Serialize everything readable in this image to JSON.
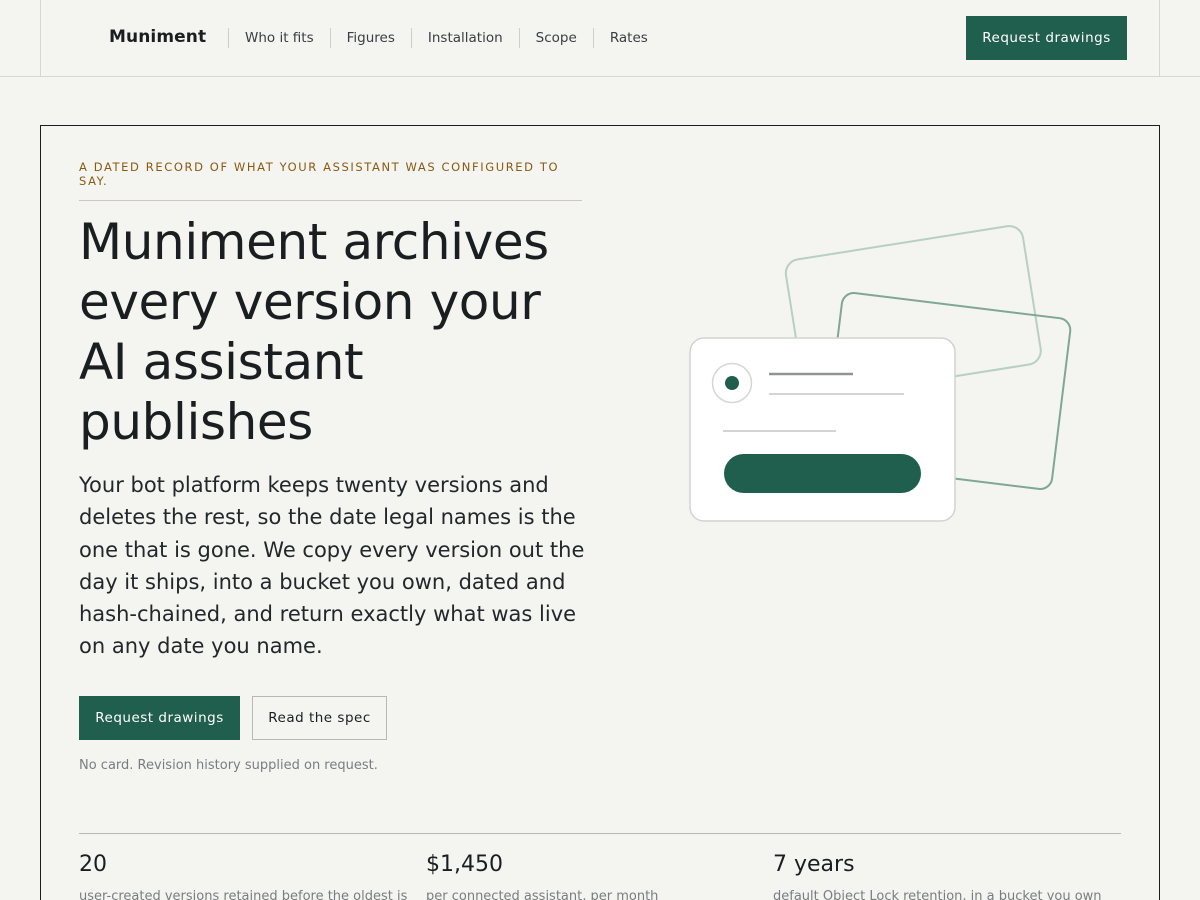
{
  "brand": "Muniment",
  "nav": [
    "Who it fits",
    "Figures",
    "Installation",
    "Scope",
    "Rates"
  ],
  "header_cta": "Request drawings",
  "hero": {
    "eyebrow": "A DATED RECORD OF WHAT YOUR ASSISTANT WAS CONFIGURED TO SAY.",
    "headline": "Muniment archives every version your AI assistant publishes",
    "lede": "Your bot platform keeps twenty versions and deletes the rest, so the date legal names is the one that is gone. We copy every version out the day it ships, into a bucket you own, dated and hash-chained, and return exactly what was live on any date you name.",
    "primary_cta": "Request drawings",
    "secondary_cta": "Read the spec",
    "fineprint": "No card. Revision history supplied on request."
  },
  "stats": [
    {
      "value": "20",
      "label": "user-created versions retained before the oldest is"
    },
    {
      "value": "$1,450",
      "label": "per connected assistant, per month"
    },
    {
      "value": "7 years",
      "label": "default Object Lock retention, in a bucket you own"
    }
  ],
  "colors": {
    "accent": "#205e4d",
    "eyebrow": "#8a5a12",
    "background": "#f4f4f1"
  },
  "illustration": "stacked-document-cards-icon"
}
